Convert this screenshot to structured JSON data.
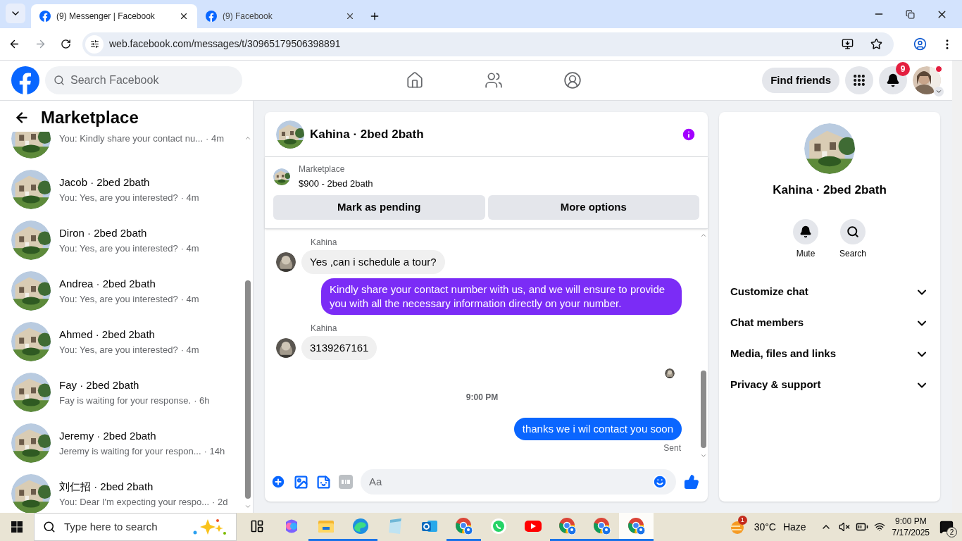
{
  "browser": {
    "tabs": [
      {
        "title": "(9) Messenger | Facebook",
        "selected": true
      },
      {
        "title": "(9) Facebook",
        "selected": false
      }
    ],
    "url": "web.facebook.com/messages/t/30965179506398891"
  },
  "header": {
    "search_placeholder": "Search Facebook",
    "find_friends": "Find friends",
    "notification_count": "9"
  },
  "sidebar": {
    "title": "Marketplace",
    "conversations": [
      {
        "preview": "You: Kindly share your contact nu...",
        "time": "· 4m"
      },
      {
        "name": "Jacob · 2bed 2bath",
        "preview": "You: Yes, are you interested?",
        "time": "· 4m"
      },
      {
        "name": "Diron · 2bed 2bath",
        "preview": "You: Yes, are you interested?",
        "time": "· 4m"
      },
      {
        "name": "Andrea · 2bed 2bath",
        "preview": "You: Yes, are you interested?",
        "time": "· 4m"
      },
      {
        "name": "Ahmed · 2bed 2bath",
        "preview": "You: Yes, are you interested?",
        "time": "· 4m"
      },
      {
        "name": "Fay · 2bed 2bath",
        "preview": "Fay is waiting for your response.",
        "time": "· 6h"
      },
      {
        "name": "Jeremy · 2bed 2bath",
        "preview": "Jeremy is waiting for your respon...",
        "time": "· 14h"
      },
      {
        "name": "刘仁招 · 2bed 2bath",
        "preview": "You: Dear I'm expecting your respo...",
        "time": "· 2d"
      }
    ]
  },
  "chat": {
    "title": "Kahina · 2bed 2bath",
    "listing_label": "Marketplace",
    "listing_title": "$900 - 2bed 2bath",
    "actions": [
      "Mark as pending",
      "More options"
    ],
    "messages": [
      {
        "kind": "incoming",
        "sender": "Kahina",
        "text": "Yes ,can i schedule a tour?"
      },
      {
        "kind": "outgoing",
        "color": "#7b2cf6",
        "text": "Kindly share your contact number with us, and we will ensure to provide you with all the necessary information directly on your number."
      },
      {
        "kind": "incoming",
        "sender": "Kahina",
        "text": "3139267161"
      },
      {
        "kind": "seen"
      },
      {
        "kind": "time",
        "text": "9:00 PM"
      },
      {
        "kind": "outgoing",
        "color": "#0a66ff",
        "text": "thanks we i wil contact you soon",
        "status": "Sent"
      }
    ],
    "composer_placeholder": "Aa"
  },
  "details": {
    "title": "Kahina · 2bed 2bath",
    "actions": [
      {
        "kind": "mute",
        "label": "Mute"
      },
      {
        "kind": "search",
        "label": "Search"
      }
    ],
    "sections": [
      "Customize chat",
      "Chat members",
      "Media, files and links",
      "Privacy & support"
    ]
  },
  "taskbar": {
    "search_placeholder": "Type here to search",
    "apps": [
      {
        "kind": "taskview",
        "running": false,
        "selected": false
      },
      {
        "kind": "copilot",
        "running": false,
        "selected": false
      },
      {
        "kind": "folder",
        "running": true,
        "selected": false
      },
      {
        "kind": "edge",
        "running": true,
        "selected": false
      },
      {
        "kind": "notepad",
        "running": false,
        "selected": false
      },
      {
        "kind": "outlook",
        "running": false,
        "selected": false
      },
      {
        "kind": "chrome",
        "running": true,
        "selected": false
      },
      {
        "kind": "whatsapp",
        "running": false,
        "selected": false
      },
      {
        "kind": "youtube",
        "running": false,
        "selected": false
      },
      {
        "kind": "chrome",
        "running": true,
        "selected": false
      },
      {
        "kind": "chrome",
        "running": true,
        "selected": false
      },
      {
        "kind": "chrome",
        "running": true,
        "selected": true
      }
    ],
    "weather_badge": "1",
    "temperature": "30°C",
    "weather": "Haze",
    "time": "9:00 PM",
    "date": "7/17/2025",
    "notifications": "2"
  }
}
